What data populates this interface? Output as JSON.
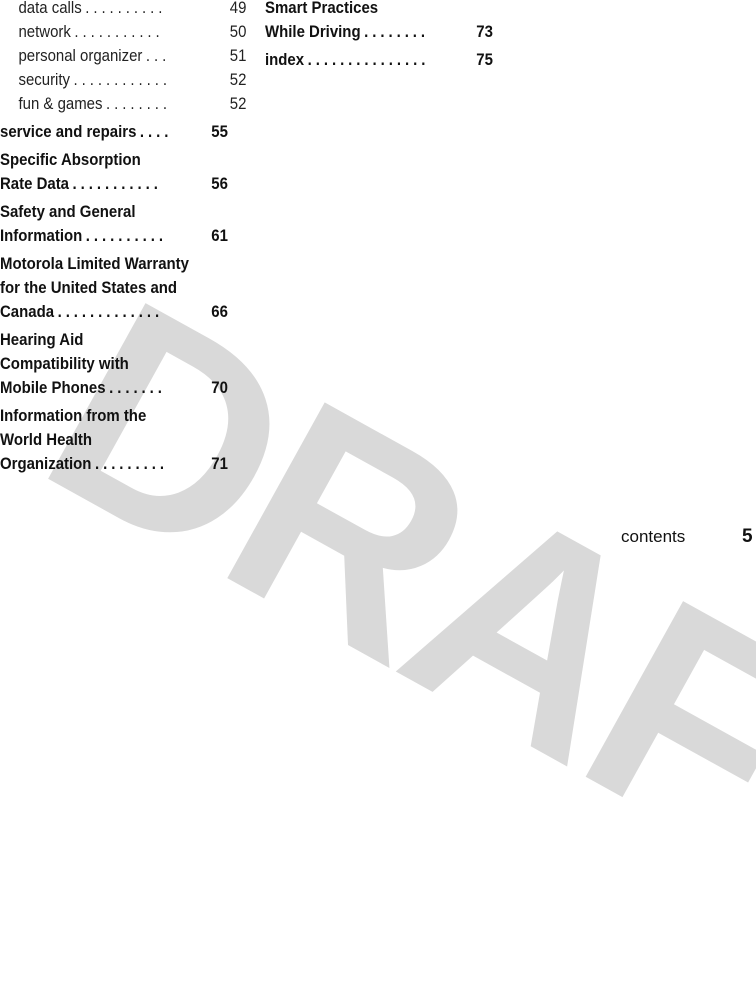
{
  "watermark": {
    "text": "DRAFT",
    "color": "#d9d9d9"
  },
  "toc_left": {
    "sub_entries": [
      {
        "label": "data calls",
        "dots": "..........",
        "page": "49"
      },
      {
        "label": "network",
        "dots": "...........",
        "page": "50"
      },
      {
        "label": "personal organizer",
        "dots": "...",
        "page": "51"
      },
      {
        "label": "security",
        "dots": "............",
        "page": "52"
      },
      {
        "label": "fun & games",
        "dots": "........",
        "page": "52"
      }
    ],
    "entries": [
      {
        "lines": [],
        "last": "service and repairs",
        "dots": "....",
        "page": "55"
      },
      {
        "lines": [
          "Specific Absorption"
        ],
        "last": "Rate Data",
        "dots": "...........",
        "page": "56"
      },
      {
        "lines": [
          "Safety and General"
        ],
        "last": "Information",
        "dots": "..........",
        "page": "61"
      },
      {
        "lines": [
          "Motorola Limited Warranty",
          "for the United States and"
        ],
        "last": "Canada",
        "dots": ".............",
        "page": "66"
      },
      {
        "lines": [
          "Hearing Aid",
          "Compatibility with"
        ],
        "last": "Mobile Phones",
        "dots": ".......",
        "page": "70"
      },
      {
        "lines": [
          "Information from the",
          "World Health"
        ],
        "last": "Organization",
        "dots": ".........",
        "page": "71"
      }
    ]
  },
  "toc_right": {
    "entries": [
      {
        "lines": [
          "Smart Practices"
        ],
        "last": "While Driving",
        "dots": "........",
        "page": "73"
      },
      {
        "lines": [],
        "last": "index",
        "dots": "...............",
        "page": "75"
      }
    ]
  },
  "footer": {
    "section_label": "contents",
    "page_number": "5"
  }
}
